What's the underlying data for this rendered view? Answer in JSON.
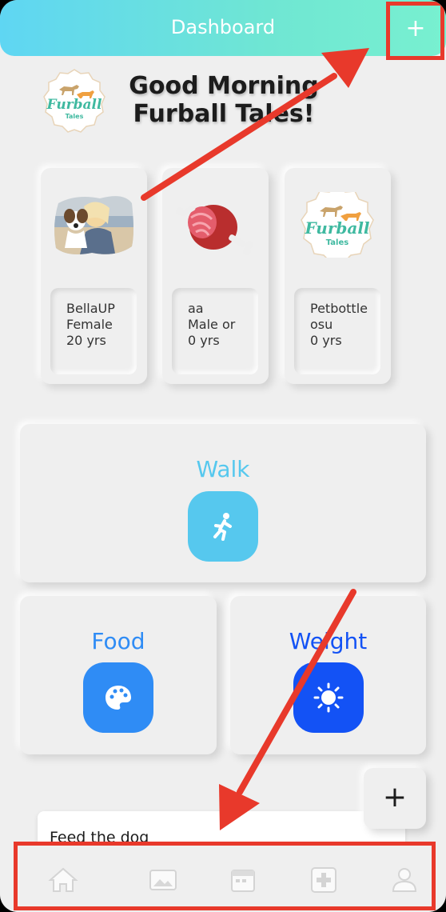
{
  "header": {
    "title": "Dashboard",
    "add_label": "+"
  },
  "greeting": {
    "line1": "Good Morning",
    "line2": "Furball Tales!"
  },
  "brand": {
    "logo_word": "Furball",
    "logo_sub": "Tales"
  },
  "pets": [
    {
      "name": "BellaUP",
      "gender": "Female",
      "age": "20 yrs",
      "image": "dog-with-owner-photo"
    },
    {
      "name": "aa",
      "gender": "Male or",
      "age": "0 yrs",
      "image": "meat-icon"
    },
    {
      "name": "Petbottle",
      "gender": "osu",
      "age": "0 yrs",
      "image": "furball-tales-logo"
    }
  ],
  "actions": {
    "walk": {
      "label": "Walk",
      "icon": "running-person-icon",
      "color": "#56c8ee"
    },
    "food": {
      "label": "Food",
      "icon": "palette-icon",
      "color": "#2f8cf5"
    },
    "weight": {
      "label": "Weight",
      "icon": "sun-icon",
      "color": "#1352f5"
    }
  },
  "fab": {
    "label": "+"
  },
  "tasks": [
    {
      "text": "Feed the dog"
    }
  ],
  "bottom_nav": [
    {
      "icon": "home-icon"
    },
    {
      "icon": "gallery-icon"
    },
    {
      "icon": "calendar-icon"
    },
    {
      "icon": "medical-icon"
    },
    {
      "icon": "profile-icon"
    }
  ],
  "annotation_color": "#e8392b"
}
